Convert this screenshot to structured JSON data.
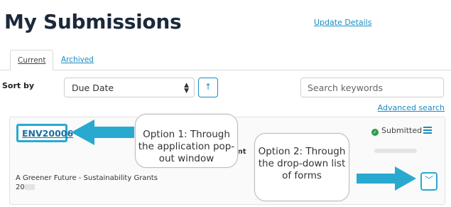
{
  "header": {
    "title": "My Submissions",
    "update_link": "Update Details"
  },
  "tabs": [
    {
      "label": "Current",
      "active": true
    },
    {
      "label": "Archived",
      "active": false
    }
  ],
  "sort": {
    "label": "Sort by",
    "value": "Due Date",
    "direction_icon": "arrow-up-icon"
  },
  "search": {
    "placeholder": "Search keywords",
    "advanced_label": "Advanced search"
  },
  "submission": {
    "reference": "ENV20006",
    "status": "Submitted",
    "status_icon": "check-circle-icon",
    "applicant_label_partial": "cant",
    "project_title": "A Greener Future - Sustainability Grants 20"
  },
  "annotations": {
    "option1": "Option 1: Through the application pop-out window",
    "option2": "Option 2: Through the drop-down list of forms",
    "arrow_color": "#29a9d0"
  }
}
